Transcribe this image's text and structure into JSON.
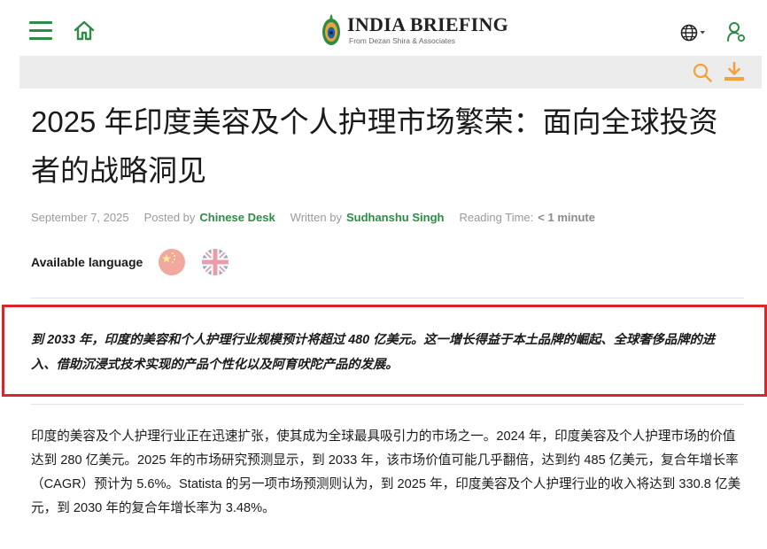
{
  "header": {
    "menu_icon": "hamburger-menu-icon",
    "home_icon": "home-icon",
    "logo": {
      "title": "INDIA BRIEFING",
      "subtitle": "From Dezan Shira & Associates"
    },
    "language_icon": "globe-icon",
    "account_icon": "user-icon"
  },
  "toolbar": {
    "search_icon": "search-icon",
    "download_icon": "download-icon"
  },
  "article": {
    "title": "2025 年印度美容及个人护理市场繁荣：面向全球投资者的战略洞见",
    "meta": {
      "date": "September 7, 2025",
      "posted_by_label": "Posted by",
      "posted_by": "Chinese Desk",
      "written_by_label": "Written by",
      "written_by": "Sudhanshu Singh",
      "reading_time_label": "Reading Time:",
      "reading_time": "< 1 minute"
    },
    "available_language_label": "Available language",
    "languages": [
      "chinese-flag",
      "uk-flag"
    ],
    "lead": "到 2033 年，印度的美容和个人护理行业规模预计将超过 480 亿美元。这一增长得益于本土品牌的崛起、全球奢侈品牌的进入、借助沉浸式技术实现的产品个性化以及阿育吠陀产品的发展。",
    "body": "印度的美容及个人护理行业正在迅速扩张，使其成为全球最具吸引力的市场之一。2024 年，印度美容及个人护理市场的价值达到 280 亿美元。2025 年的市场研究预测显示，到 2033 年，该市场价值可能几乎翻倍，达到约 485 亿美元，复合年增长率（CAGR）预计为 5.6%。Statista 的另一项市场预测则认为，到 2025 年，印度美容及个人护理行业的收入将达到 330.8 亿美元，到 2030 年的复合年增长率为 3.48%。"
  },
  "colors": {
    "brand_green": "#2e8b45",
    "accent_orange": "#f5a03a",
    "highlight_red": "#d9262b",
    "toolbar_gray": "#ececec"
  }
}
